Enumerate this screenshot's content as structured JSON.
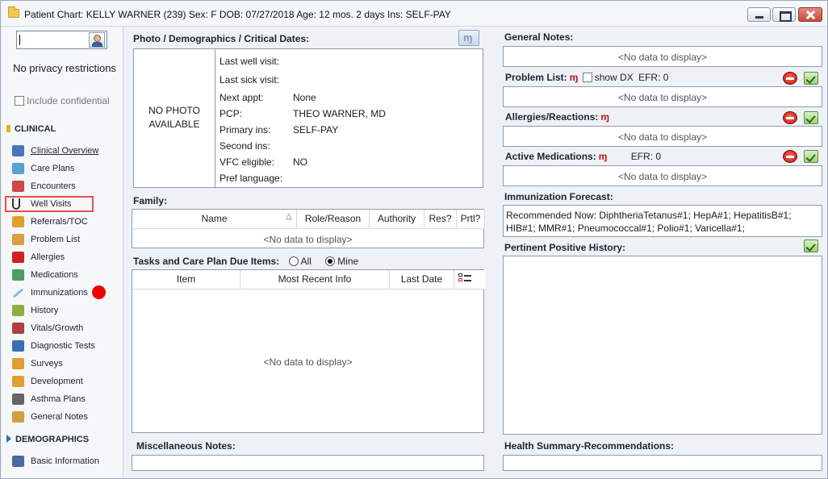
{
  "titlebar": {
    "title": "Patient Chart: KELLY WARNER (239)  Sex: F  DOB: 07/27/2018  Age: 12 mos. 2 days  Ins: SELF-PAY"
  },
  "sidebar": {
    "privacy_text": "No privacy restrictions",
    "include_confidential": "Include confidential",
    "clinical_header": "CLINICAL",
    "demographics_header": "DEMOGRAPHICS",
    "clinical_items": [
      {
        "label": "Clinical Overview",
        "icon": "clinical-overview-icon",
        "color": "#4a76b8"
      },
      {
        "label": "Care Plans",
        "icon": "care-plans-icon",
        "color": "#5aa0d0"
      },
      {
        "label": "Encounters",
        "icon": "encounters-icon",
        "color": "#d04848"
      },
      {
        "label": "Well Visits",
        "icon": "stethoscope-icon",
        "color": "#333333"
      },
      {
        "label": "Referrals/TOC",
        "icon": "referrals-icon",
        "color": "#e0a030"
      },
      {
        "label": "Problem List",
        "icon": "problem-list-icon",
        "color": "#d8a040"
      },
      {
        "label": "Allergies",
        "icon": "allergies-icon",
        "color": "#d02020"
      },
      {
        "label": "Medications",
        "icon": "medications-icon",
        "color": "#4aa060"
      },
      {
        "label": "Immunizations",
        "icon": "syringe-icon",
        "color": "#8ab8e0"
      },
      {
        "label": "History",
        "icon": "history-tree-icon",
        "color": "#8cb040"
      },
      {
        "label": "Vitals/Growth",
        "icon": "vitals-pencil-icon",
        "color": "#b04040"
      },
      {
        "label": "Diagnostic Tests",
        "icon": "diagnostic-tests-icon",
        "color": "#3a70b0"
      },
      {
        "label": "Surveys",
        "icon": "surveys-icon",
        "color": "#e0a030"
      },
      {
        "label": "Development",
        "icon": "development-icon",
        "color": "#e0a030"
      },
      {
        "label": "Asthma Plans",
        "icon": "asthma-plans-icon",
        "color": "#666666"
      },
      {
        "label": "General Notes",
        "icon": "general-notes-icon",
        "color": "#d0a040"
      }
    ],
    "demographic_items": [
      {
        "label": "Basic Information",
        "icon": "basic-information-icon",
        "color": "#4a6aa0"
      }
    ]
  },
  "demographics": {
    "header": "Photo / Demographics / Critical Dates:",
    "photo_text": "NO PHOTO AVAILABLE",
    "rows": [
      {
        "key": "Last well visit:",
        "value": ""
      },
      {
        "key": "Last sick visit:",
        "value": ""
      },
      {
        "key": "Next appt:",
        "value": "None"
      },
      {
        "key": "PCP:",
        "value": "THEO WARNER, MD"
      },
      {
        "key": "Primary ins:",
        "value": "SELF-PAY"
      },
      {
        "key": "Second ins:",
        "value": ""
      },
      {
        "key": "VFC eligible:",
        "value": "NO"
      },
      {
        "key": "Pref language:",
        "value": ""
      }
    ]
  },
  "family": {
    "header": "Family:",
    "columns": [
      "Name",
      "Role/Reason",
      "Authority",
      "Res?",
      "Prtl?"
    ],
    "empty_text": "<No data to display>"
  },
  "tasks": {
    "header": "Tasks and Care Plan Due Items:",
    "radio_all": "All",
    "radio_mine": "Mine",
    "selected": "Mine",
    "columns": [
      "Item",
      "Most Recent Info",
      "Last Date"
    ],
    "empty_text": "<No data to display>"
  },
  "misc_notes": {
    "header": "Miscellaneous Notes:"
  },
  "general_notes": {
    "header": "General Notes:",
    "empty_text": "<No data to display>"
  },
  "problem_list": {
    "header": "Problem List:",
    "show_dx": "show DX",
    "efr": "EFR: 0",
    "empty_text": "<No data to display>"
  },
  "allergies": {
    "header": "Allergies/Reactions:",
    "empty_text": "<No data to display>"
  },
  "active_meds": {
    "header": "Active Medications:",
    "efr": "EFR: 0",
    "empty_text": "<No data to display>"
  },
  "immunization_forecast": {
    "header": "Immunization Forecast:",
    "text": "Recommended Now: DiphtheriaTetanus#1;  HepA#1;  HepatitisB#1;  HIB#1;  MMR#1;  Pneumococcal#1;  Polio#1;  Varicella#1;"
  },
  "pertinent_positive": {
    "header": "Pertinent Positive History:"
  },
  "health_summary": {
    "header": "Health Summary-Recommendations:"
  }
}
